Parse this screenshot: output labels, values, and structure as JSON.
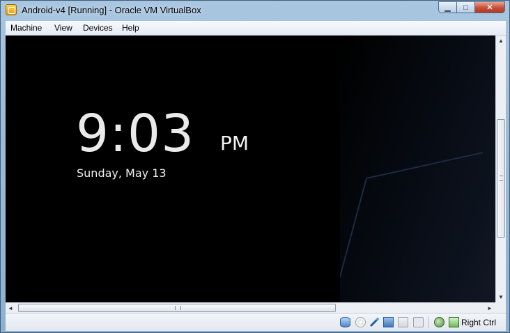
{
  "window": {
    "title": "Android-v4 [Running] - Oracle VM VirtualBox",
    "buttons": {
      "minimize": "▁",
      "maximize": "□",
      "close": "✕"
    }
  },
  "menubar": {
    "items": [
      {
        "label": "Machine"
      },
      {
        "label": "View"
      },
      {
        "label": "Devices"
      },
      {
        "label": "Help"
      }
    ]
  },
  "guest": {
    "clock": {
      "time": "9:03",
      "ampm": "PM",
      "date": "Sunday, May 13"
    }
  },
  "scrollbars": {
    "arrows": {
      "up": "▲",
      "down": "▼",
      "left": "◄",
      "right": "►"
    }
  },
  "statusbar": {
    "icons": [
      "hard-disk-icon",
      "optical-drive-icon",
      "usb-icon",
      "network-icon",
      "shared-folders-icon",
      "remote-display-icon",
      "virtualization-icon",
      "keyboard-capture-icon"
    ],
    "host_key": "Right Ctrl"
  }
}
